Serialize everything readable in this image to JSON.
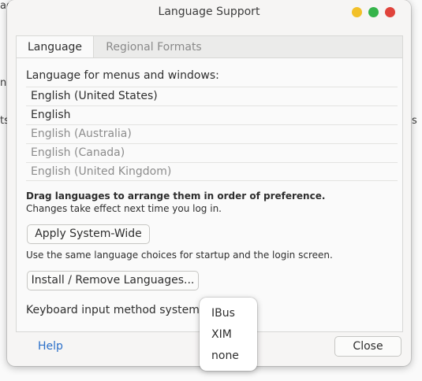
{
  "background": {
    "fragments": [
      "ag",
      "na",
      "ts",
      "s"
    ]
  },
  "window": {
    "title": "Language Support",
    "tabs": [
      {
        "label": "Language",
        "active": true
      },
      {
        "label": "Regional Formats",
        "active": false
      }
    ],
    "language_heading": "Language for menus and windows:",
    "languages": [
      {
        "label": "English (United States)",
        "enabled": true
      },
      {
        "label": "English",
        "enabled": true
      },
      {
        "label": "English (Australia)",
        "enabled": false
      },
      {
        "label": "English (Canada)",
        "enabled": false
      },
      {
        "label": "English (United Kingdom)",
        "enabled": false
      }
    ],
    "drag_hint": "Drag languages to arrange them in order of preference.",
    "changes_hint": "Changes take effect next time you log in.",
    "apply_button": "Apply System-Wide",
    "startup_hint": "Use the same language choices for startup and the login screen.",
    "install_button": "Install / Remove Languages...",
    "keyboard_label": "Keyboard input method system:",
    "help_link": "Help",
    "close_button": "Close"
  },
  "dropdown": {
    "options": [
      "IBus",
      "XIM",
      "none"
    ]
  },
  "colors": {
    "accent_link": "#2a6fc9",
    "minimize": "#f2c028",
    "maximize": "#35b44a",
    "close": "#e0433b"
  }
}
